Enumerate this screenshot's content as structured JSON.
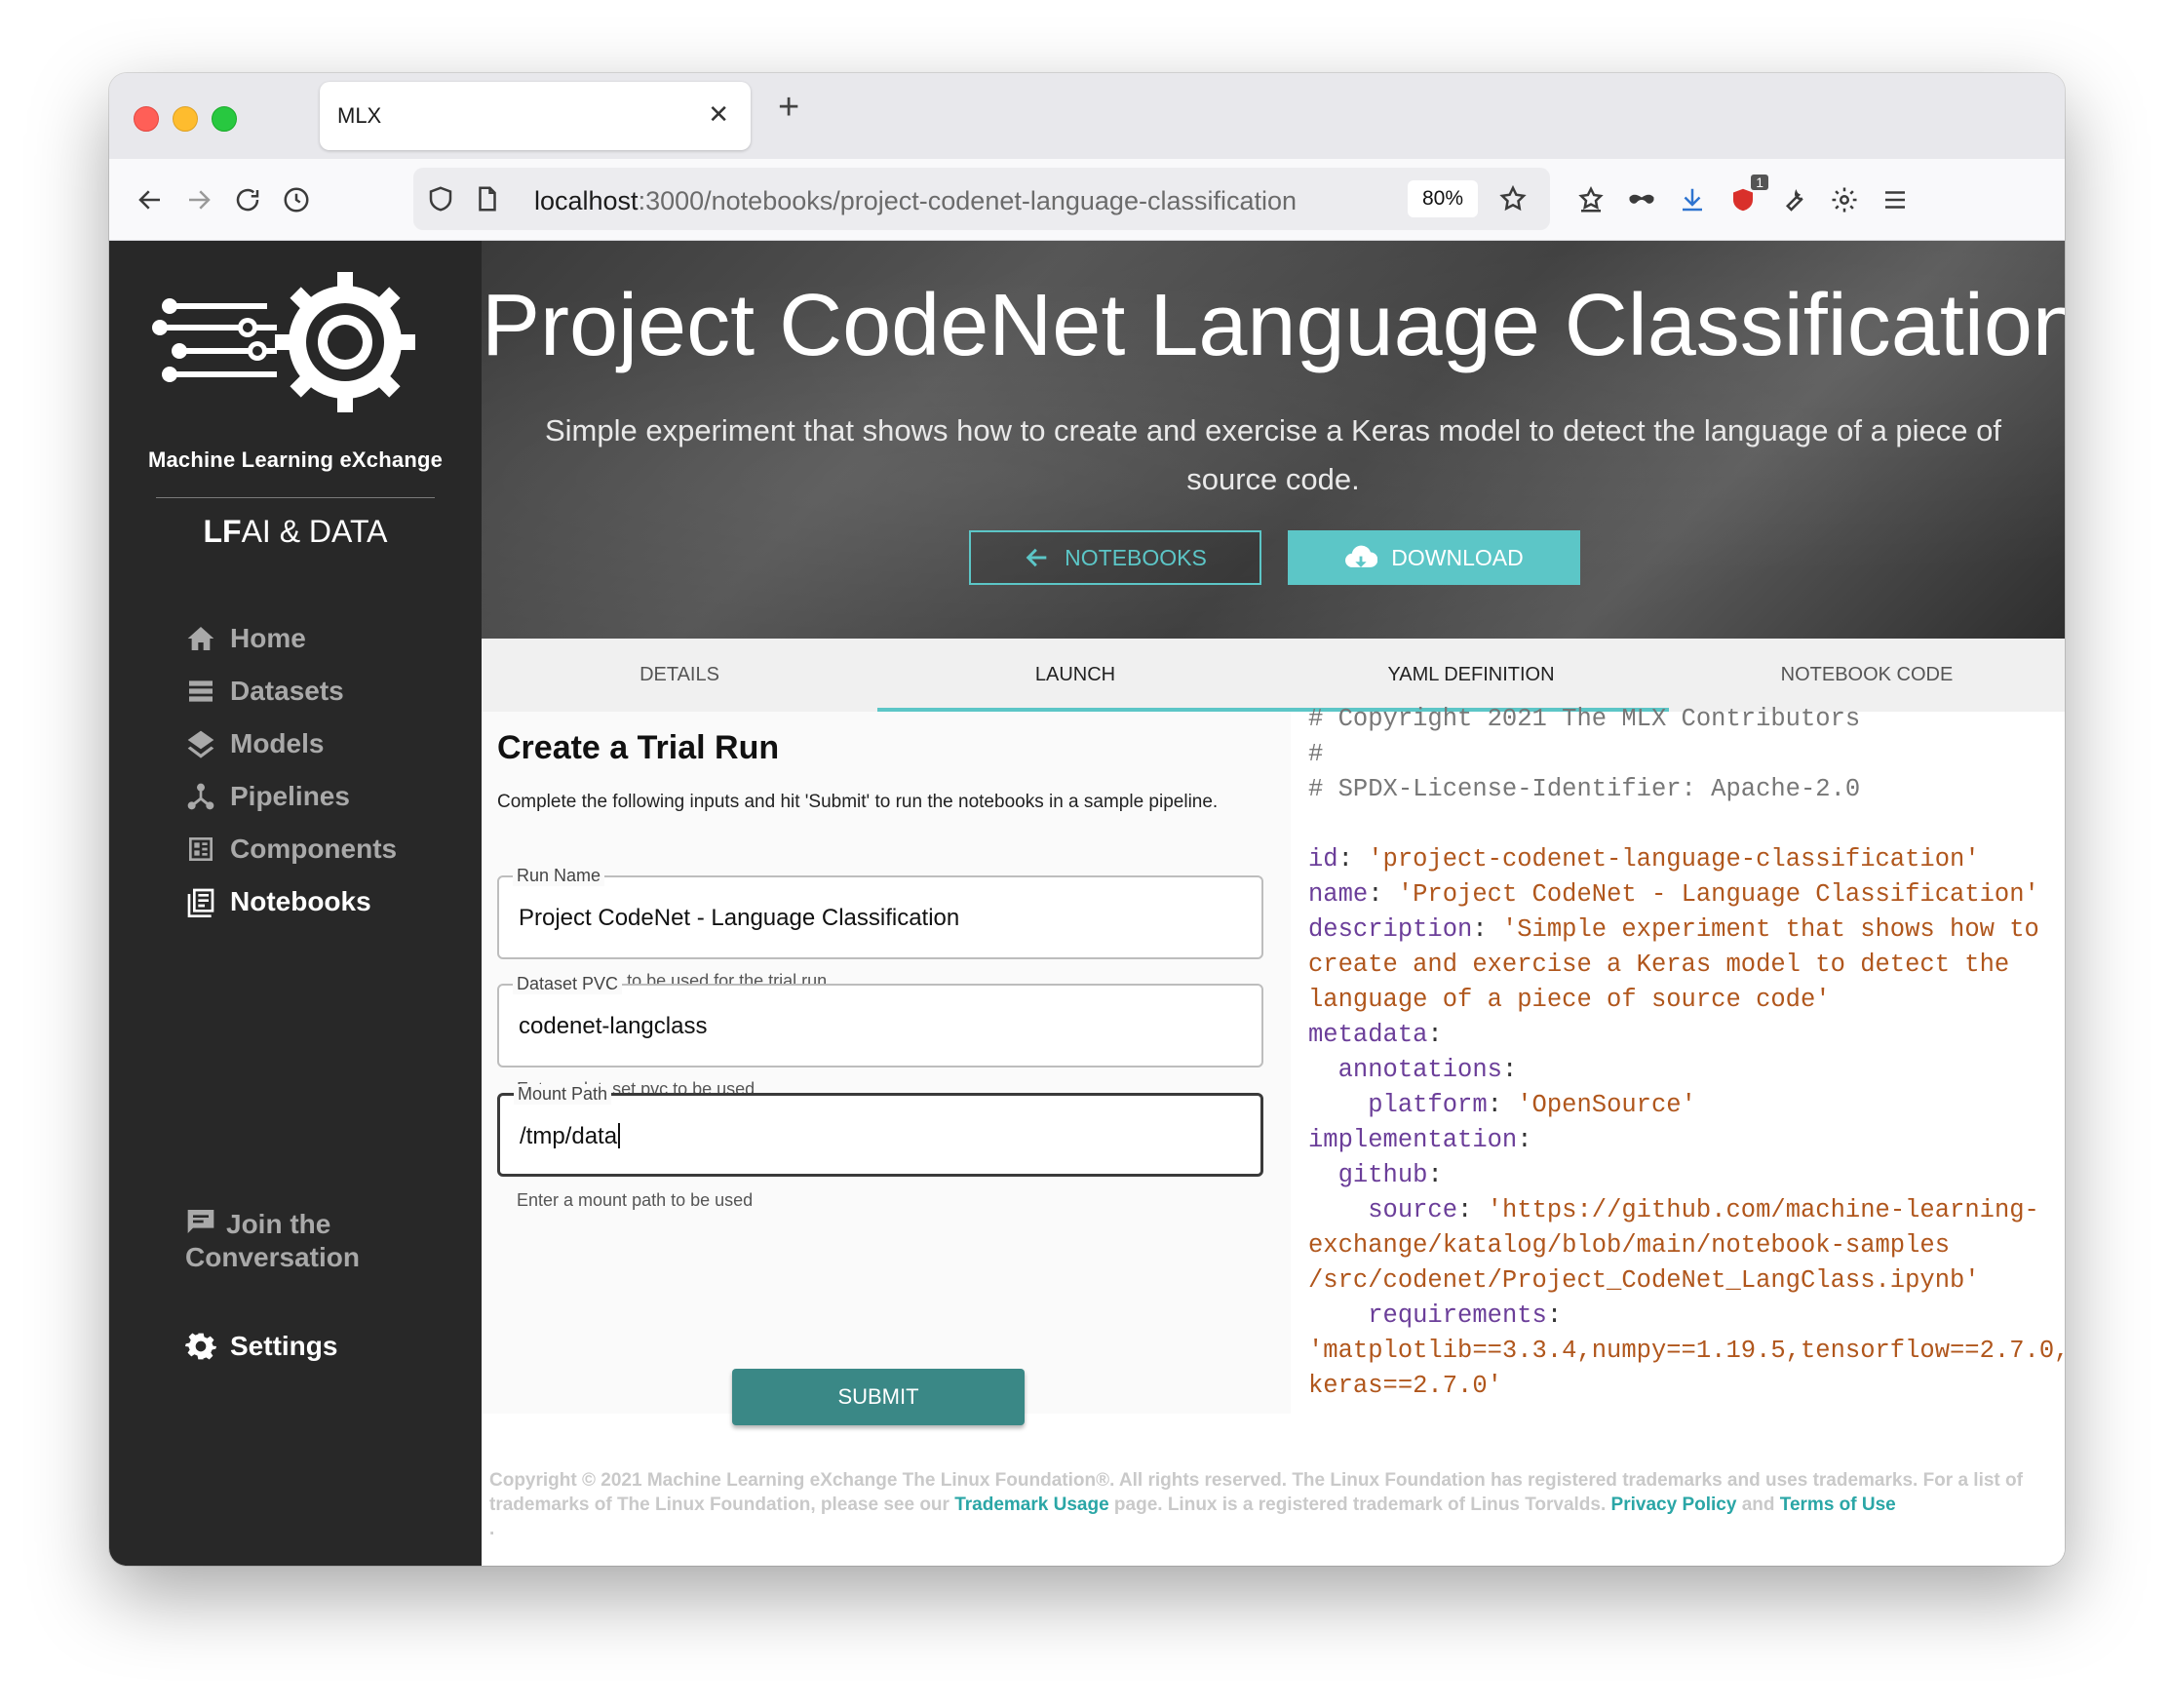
{
  "browser": {
    "tab_title": "MLX",
    "url_host": "localhost",
    "url_path": ":3000/notebooks/project-codenet-language-classification",
    "zoom": "80%",
    "extension_badge": "1"
  },
  "sidebar": {
    "brand": "Machine Learning eXchange",
    "partner_lf": "LF",
    "partner_rest": "AI & DATA",
    "items": [
      {
        "label": "Home",
        "icon": "home-icon"
      },
      {
        "label": "Datasets",
        "icon": "datasets-icon"
      },
      {
        "label": "Models",
        "icon": "layers-icon"
      },
      {
        "label": "Pipelines",
        "icon": "pipeline-icon"
      },
      {
        "label": "Components",
        "icon": "components-icon"
      },
      {
        "label": "Notebooks",
        "icon": "notebook-icon",
        "active": true
      }
    ],
    "join_line1": "Join the",
    "join_line2": "Conversation",
    "settings": "Settings"
  },
  "hero": {
    "title": "Project CodeNet Language Classification",
    "description": "Simple experiment that shows how to create and exercise a Keras model to detect the language of a piece of source code.",
    "back_button": "NOTEBOOKS",
    "download_button": "DOWNLOAD"
  },
  "tabs": [
    "DETAILS",
    "LAUNCH",
    "YAML DEFINITION",
    "NOTEBOOK CODE"
  ],
  "form": {
    "title": "Create a Trial Run",
    "description": "Complete the following inputs and hit 'Submit' to run the notebooks in a sample pipeline.",
    "run_name": {
      "label": "Run Name",
      "value": "Project CodeNet - Language Classification",
      "helper": "Enter a name to be used for the trial run."
    },
    "dataset_pvc": {
      "label": "Dataset PVC",
      "value": "codenet-langclass",
      "helper": "Enter a dataset pvc to be used"
    },
    "mount_path": {
      "label": "Mount Path",
      "value": "/tmp/data",
      "helper": "Enter a mount path to be used"
    },
    "submit": "SUBMIT"
  },
  "yaml": {
    "comment1": "# Copyright 2021 The MLX Contributors",
    "comment2": "#",
    "comment3": "# SPDX-License-Identifier: Apache-2.0",
    "id_key": "id",
    "id_val": "'project-codenet-language-classification'",
    "name_key": "name",
    "name_val": "'Project CodeNet - Language Classification'",
    "desc_key": "description",
    "desc_val1": "'Simple experiment that shows how to",
    "desc_val2": "create and exercise a Keras model to detect the",
    "desc_val3": "language of a piece of source code'",
    "metadata_key": "metadata",
    "annotations_key": "annotations",
    "platform_key": "platform",
    "platform_val": "'OpenSource'",
    "implementation_key": "implementation",
    "github_key": "github",
    "source_key": "source",
    "source_val1": "'https://github.com/machine-learning-",
    "source_val2": "exchange/katalog/blob/main/notebook-samples",
    "source_val3": "/src/codenet/Project_CodeNet_LangClass.ipynb'",
    "requirements_key": "requirements",
    "req_val1": "'matplotlib==3.3.4,numpy==1.19.5,tensorflow==2.7.0,",
    "req_val2": "keras==2.7.0'"
  },
  "footer": {
    "text1": "Copyright © 2021 Machine Learning eXchange The Linux Foundation®. All rights reserved. The Linux Foundation has registered trademarks and uses trademarks. For a list of trademarks of The Linux Foundation, please see our ",
    "trademark_link": "Trademark Usage",
    "text2": " page. Linux is a registered trademark of Linus Torvalds. ",
    "privacy_link": "Privacy Policy",
    "and": " and ",
    "terms_link": "Terms of Use",
    "trailing": "."
  },
  "colors": {
    "accent": "#5cc6c7",
    "submit": "#3a8886",
    "sidebar": "#282828",
    "yaml_key": "#6b3e99",
    "yaml_string": "#b0561c"
  }
}
